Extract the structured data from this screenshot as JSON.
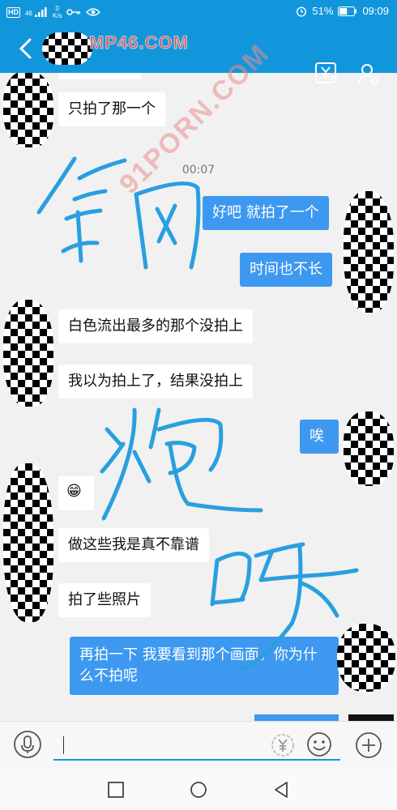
{
  "status_bar": {
    "hd": "HD",
    "signal": "46",
    "net_speed_value": "0",
    "net_speed_unit": "K/s",
    "battery": "51%",
    "time": "09:09"
  },
  "header": {
    "title": "",
    "watermark": "MP46.COM"
  },
  "watermark_diagonal": "91PORN.COM",
  "messages": [
    {
      "side": "in",
      "text": "只拍了那一个"
    },
    {
      "type": "time",
      "text": "00:07"
    },
    {
      "side": "out",
      "text": "好吧 就拍了一个"
    },
    {
      "side": "out",
      "text": "时间也不长"
    },
    {
      "side": "in",
      "text": "白色流出最多的那个没拍上"
    },
    {
      "side": "in",
      "text": "我以为拍上了，结果没拍上"
    },
    {
      "side": "out",
      "text": "唉"
    },
    {
      "side": "in",
      "text": "😁"
    },
    {
      "side": "in",
      "text": "做这些我是真不靠谱"
    },
    {
      "side": "in",
      "text": "拍了些照片"
    },
    {
      "side": "out",
      "text": "再拍一下 我要看到那个画面。你为什么不拍呢"
    }
  ],
  "input": {
    "placeholder": ""
  },
  "icons": [
    "back-arrow-icon",
    "yen-transfer-icon",
    "user-settings-icon",
    "mic-icon",
    "yen-icon",
    "smiley-icon",
    "plus-icon",
    "square-nav-icon",
    "circle-nav-icon",
    "triangle-back-nav-icon"
  ],
  "colors": {
    "header": "#1296db",
    "out_bubble": "#3d98f0",
    "in_bubble": "#ffffff",
    "scribble": "#2a9fe0"
  }
}
